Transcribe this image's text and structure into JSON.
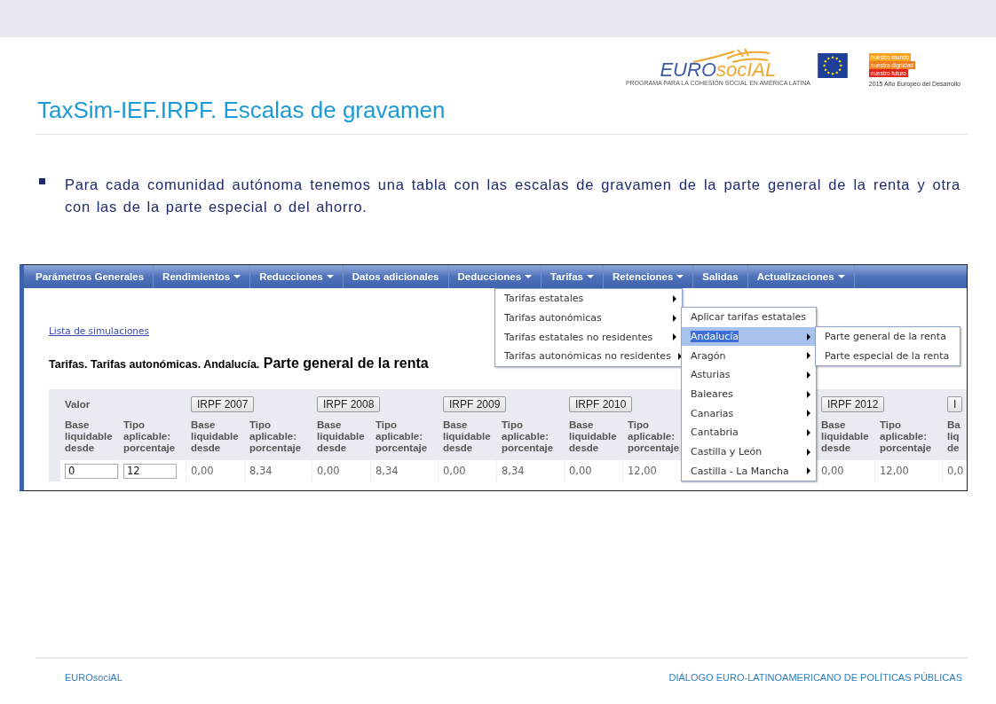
{
  "logos": {
    "wordmark": [
      "EURO",
      "socIAL"
    ],
    "tagline": "PROGRAMA PARA LA COHESIÓN SOCIAL EN AMÉRICA LATINA",
    "slogan": [
      {
        "text": "nuestro mundo",
        "color": "#f5a21e"
      },
      {
        "text": "nuestra dignidad",
        "color": "#ef7d1c"
      },
      {
        "text": "nuestro futuro",
        "color": "#e0261b"
      }
    ],
    "year_note": "2015 Año Europeo del Desarrollo"
  },
  "title": "TaxSim-IEF.IRPF. Escalas de gravamen",
  "bullet": "Para cada comunidad autónoma tenemos una tabla con las escalas de gravamen de la parte general de la renta y otra con las de la parte especial o del ahorro.",
  "screenshot": {
    "menu_bar": [
      {
        "label": "Parámetros Generales",
        "dropdown": false
      },
      {
        "label": "Rendimientos",
        "dropdown": true
      },
      {
        "label": "Reducciones",
        "dropdown": true
      },
      {
        "label": "Datos adicionales",
        "dropdown": false
      },
      {
        "label": "Deducciones",
        "dropdown": true
      },
      {
        "label": "Tarifas",
        "dropdown": true
      },
      {
        "label": "Retenciones",
        "dropdown": true
      },
      {
        "label": "Salidas",
        "dropdown": false
      },
      {
        "label": "Actualizaciones",
        "dropdown": true
      }
    ],
    "link": "Lista de simulaciones",
    "heading": {
      "path": "Tarifas. Tarifas autonómicas. Andalucía.",
      "title": "Parte general de la renta"
    },
    "table": {
      "groups": [
        {
          "kind": "input",
          "label": "Valor",
          "headers": [
            [
              "Base",
              "liquidable",
              "desde"
            ],
            [
              "Tipo",
              "aplicable:",
              "porcentaje"
            ]
          ],
          "row": [
            "0",
            "12"
          ]
        },
        {
          "kind": "year",
          "button": "IRPF 2007",
          "headers": [
            [
              "Base",
              "liquidable",
              "desde"
            ],
            [
              "Tipo",
              "aplicable:",
              "porcentaje"
            ]
          ],
          "row": [
            "0,00",
            "8,34"
          ]
        },
        {
          "kind": "year",
          "button": "IRPF 2008",
          "headers": [
            [
              "Base",
              "liquidable",
              "desde"
            ],
            [
              "Tipo",
              "aplicable:",
              "porcentaje"
            ]
          ],
          "row": [
            "0,00",
            "8,34"
          ]
        },
        {
          "kind": "year",
          "button": "IRPF 2009",
          "headers": [
            [
              "Base",
              "liquidable",
              "desde"
            ],
            [
              "Tipo",
              "aplicable:",
              "porcentaje"
            ]
          ],
          "row": [
            "0,00",
            "8,34"
          ]
        },
        {
          "kind": "year",
          "button": "IRPF 2010",
          "headers": [
            [
              "Base",
              "liquidable",
              "desde"
            ],
            [
              "Tipo",
              "aplicable:",
              "porcentaje"
            ]
          ],
          "row": [
            "0,00",
            "12,00"
          ]
        },
        {
          "kind": "hidden"
        },
        {
          "kind": "year",
          "button": "IRPF 2012",
          "headers": [
            [
              "Base",
              "liquidable",
              "desde"
            ],
            [
              "Tipo",
              "aplicable:",
              "porcentaje"
            ]
          ],
          "row": [
            "0,00",
            "12,00"
          ]
        },
        {
          "kind": "partial",
          "button": "I",
          "headers": [
            [
              "Ba",
              "liq",
              "de"
            ]
          ],
          "row": [
            "0,0"
          ]
        }
      ]
    },
    "dropdown": [
      {
        "label": "Tarifas estatales",
        "submenu": true
      },
      {
        "label": "Tarifas autonómicas",
        "submenu": true
      },
      {
        "label": "Tarifas estatales no residentes",
        "submenu": true
      },
      {
        "label": "Tarifas autonómicas no residentes",
        "submenu": true
      }
    ],
    "submenu": [
      {
        "label": "Aplicar tarifas estatales",
        "submenu": false,
        "selected": false
      },
      {
        "label": "Andalucía",
        "submenu": true,
        "selected": true
      },
      {
        "label": "Aragón",
        "submenu": true,
        "selected": false
      },
      {
        "label": "Asturias",
        "submenu": true,
        "selected": false
      },
      {
        "label": "Baleares",
        "submenu": true,
        "selected": false
      },
      {
        "label": "Canarias",
        "submenu": true,
        "selected": false
      },
      {
        "label": "Cantabria",
        "submenu": true,
        "selected": false
      },
      {
        "label": "Castilla y León",
        "submenu": true,
        "selected": false
      },
      {
        "label": "Castilla - La Mancha",
        "submenu": true,
        "selected": false
      }
    ],
    "sub_submenu": [
      {
        "label": "Parte general de la renta",
        "submenu": false
      },
      {
        "label": "Parte especial de la renta",
        "submenu": false
      }
    ]
  },
  "footer": {
    "left": "EUROsociAL",
    "right": "DIÁLOGO EURO-LATINOAMERICANO DE POLÍTICAS PÚBLICAS"
  }
}
